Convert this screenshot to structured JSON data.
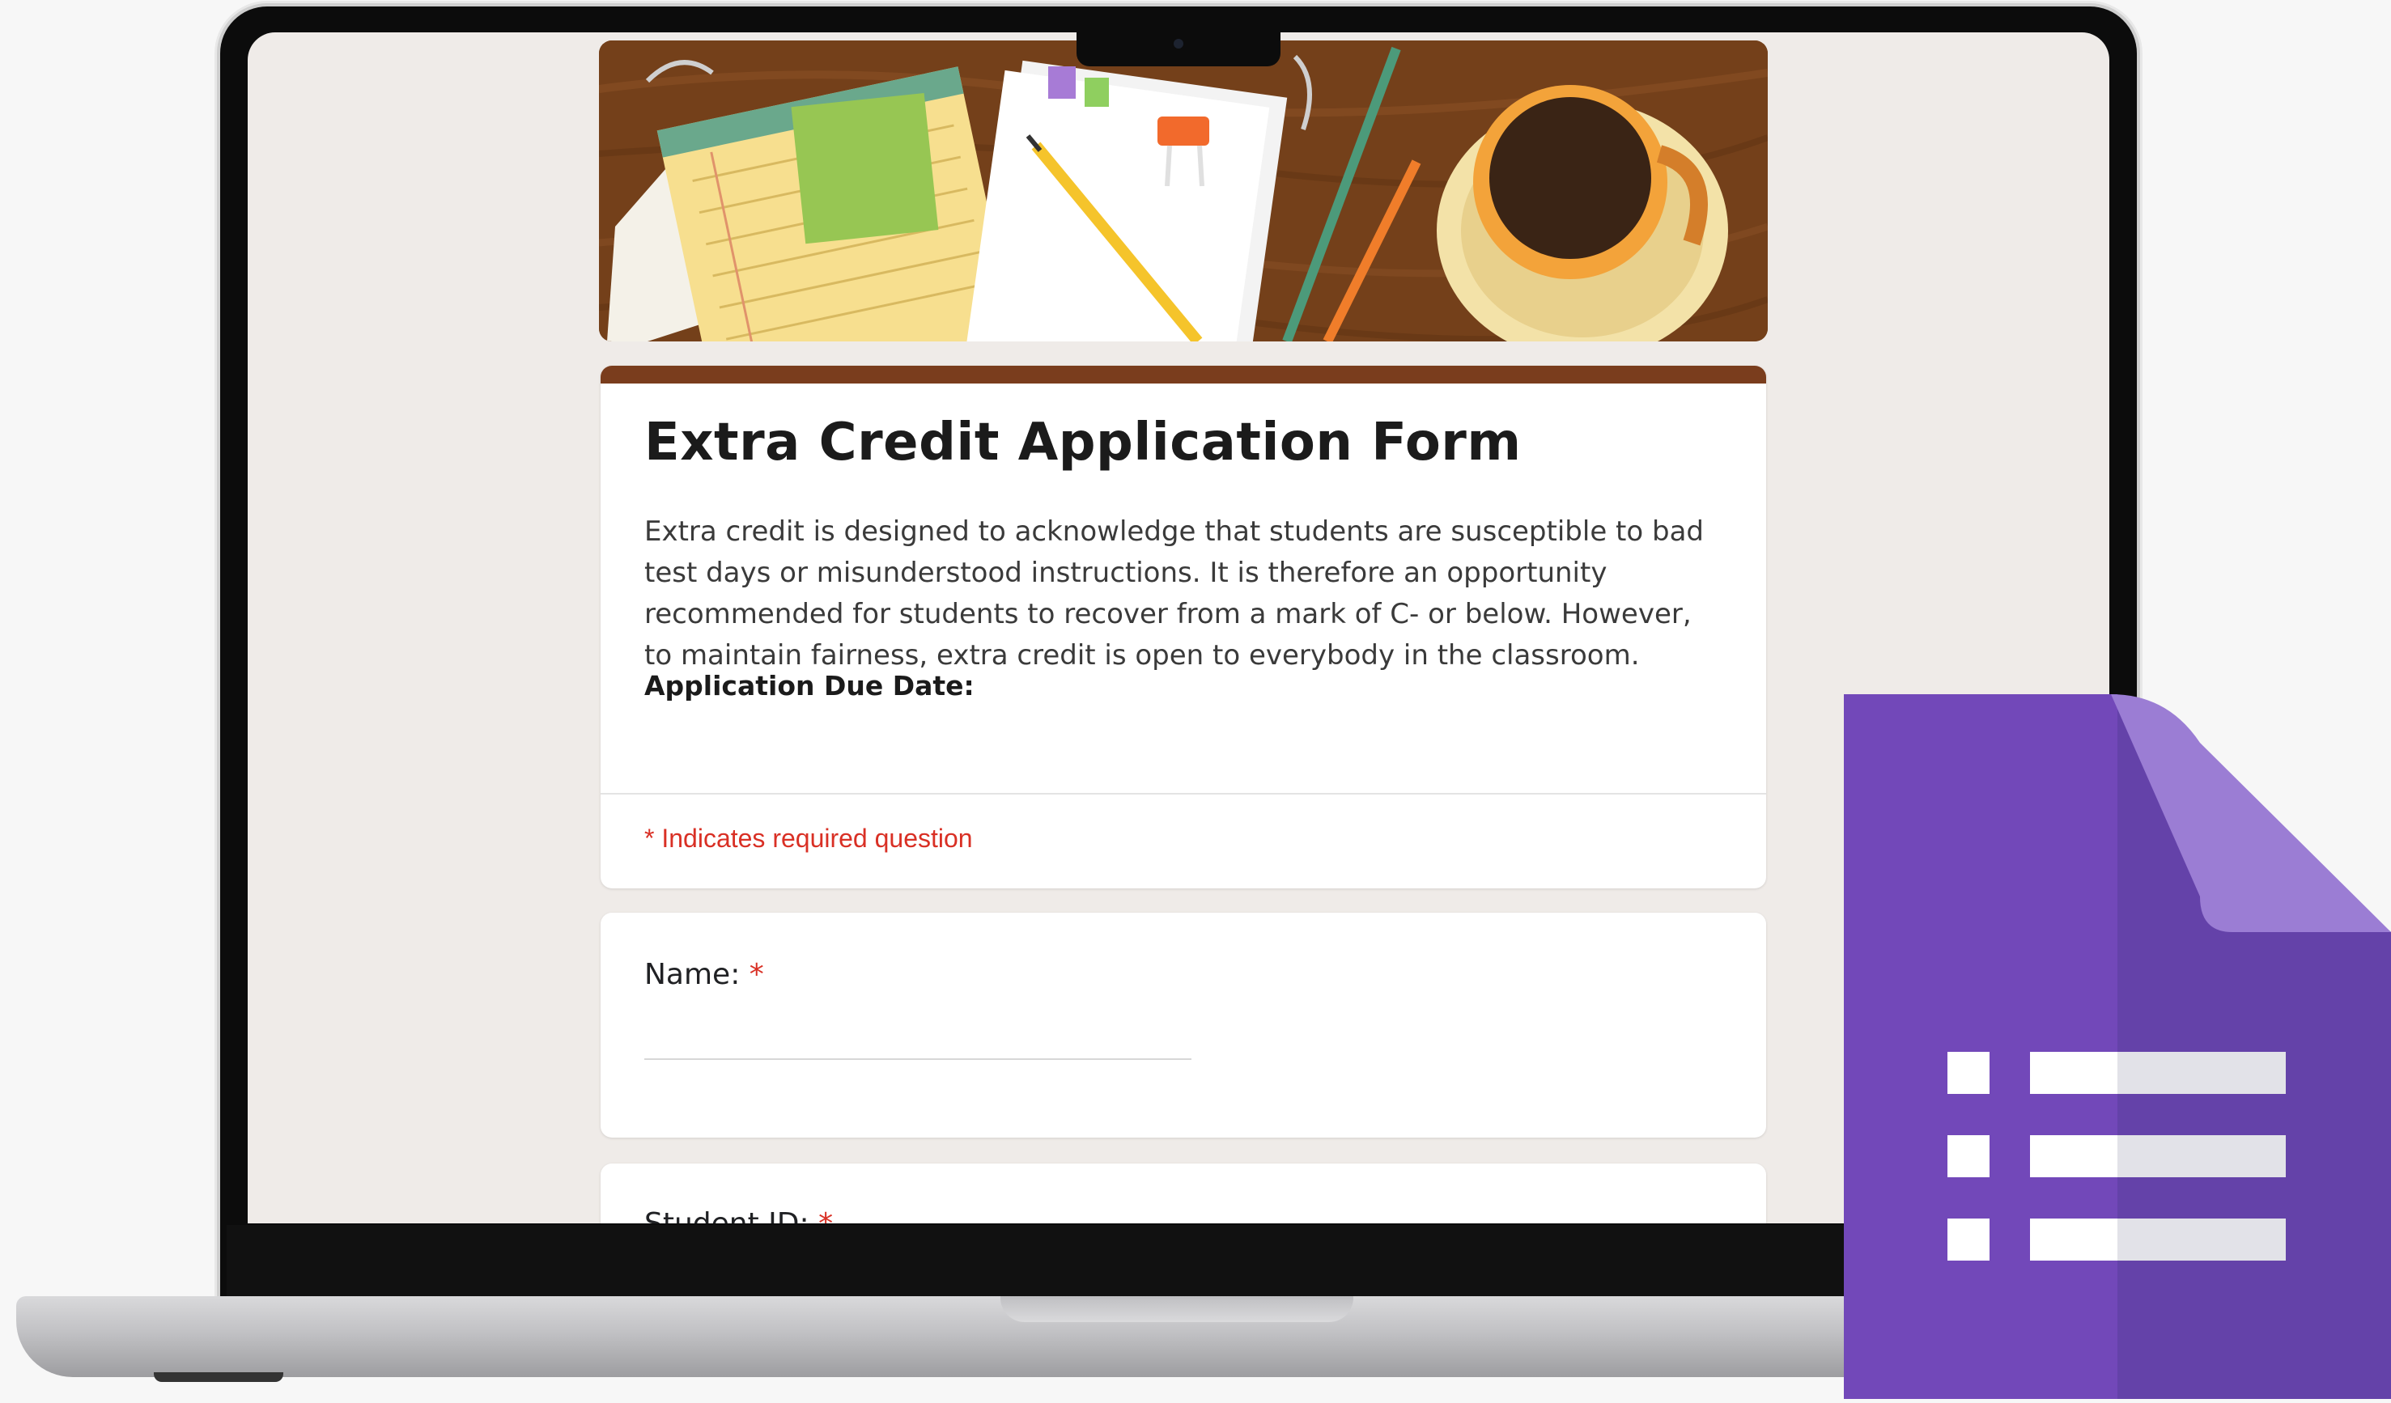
{
  "form": {
    "title": "Extra Credit Application Form",
    "description": "Extra credit is designed to acknowledge that students are susceptible to bad test days or misunderstood instructions. It is therefore an opportunity recommended for students to recover from a mark of C- or below. However, to maintain fairness, extra credit is open to everybody in the classroom.",
    "due_date_label": "Application Due Date:",
    "required_note": "* Indicates required question",
    "header_image": "desk-with-notepad-pencils-coffee",
    "accent_color": "#7a3d1d",
    "required_color": "#d93025"
  },
  "questions": [
    {
      "label": "Name:",
      "required_marker": "*",
      "value": ""
    },
    {
      "label": "Student ID:",
      "required_marker": "*",
      "value": ""
    }
  ],
  "logo": {
    "icon": "google-forms-icon",
    "color": "#7248b9"
  }
}
